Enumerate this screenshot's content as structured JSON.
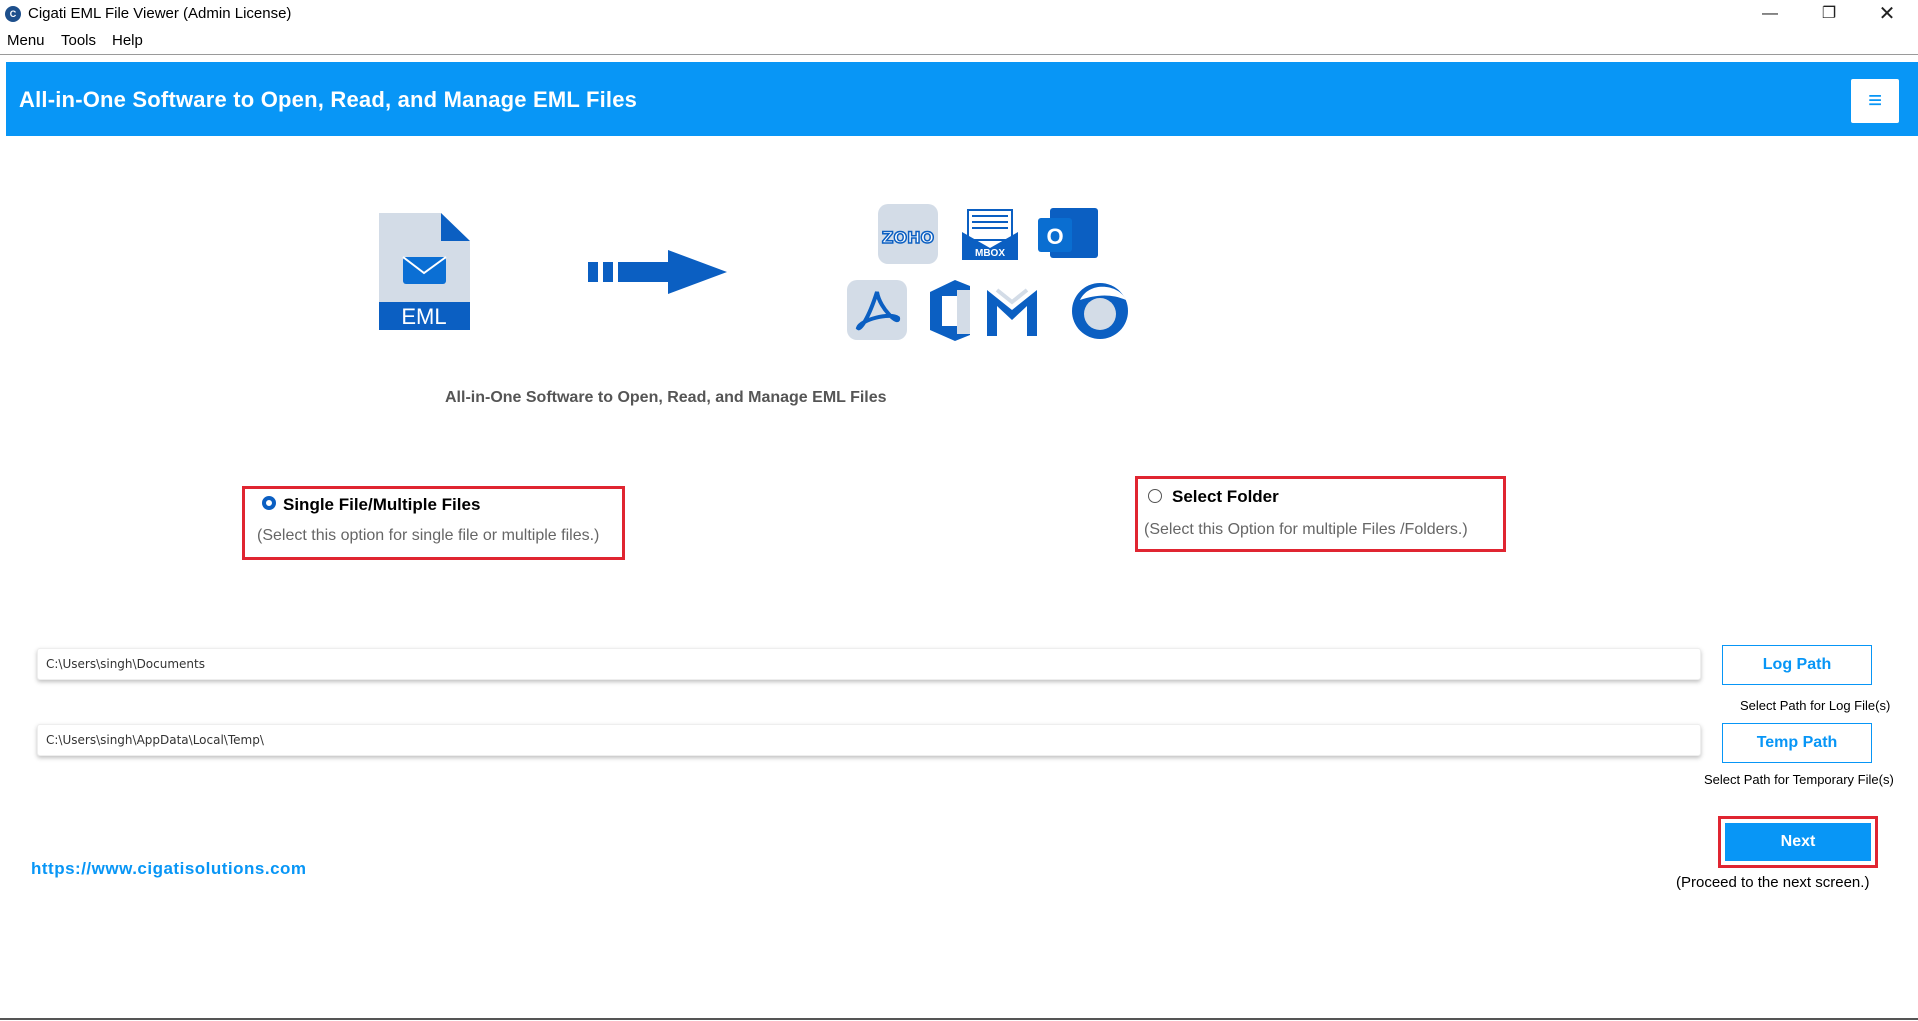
{
  "window": {
    "title": "Cigati EML File Viewer (Admin License)",
    "app_icon": "C",
    "controls": [
      "minimize-icon",
      "restore-icon",
      "close-icon"
    ]
  },
  "menubar": {
    "items": [
      "Menu",
      "Tools",
      "Help"
    ]
  },
  "banner": {
    "title": "All-in-One Software to Open, Read, and Manage EML Files",
    "menu_icon": "hamburger-icon"
  },
  "illustration": {
    "source_label": "EML",
    "targets": [
      "ZOHO",
      "MBOX",
      "O"
    ],
    "tagline": "All-in-One Software to Open, Read, and Manage EML Files"
  },
  "options": [
    {
      "title": "Single File/Multiple Files",
      "description": "(Select this option for single file or multiple files.)",
      "selected": true
    },
    {
      "title": "Select Folder",
      "description": "(Select this Option for multiple Files /Folders.)",
      "selected": false
    }
  ],
  "paths": {
    "log": {
      "value": "C:\\Users\\singh\\Documents",
      "button": "Log Path",
      "hint": "Select Path for Log File(s)"
    },
    "temp": {
      "value": "C:\\Users\\singh\\AppData\\Local\\Temp\\",
      "button": "Temp Path",
      "hint": "Select Path for  Temporary File(s)"
    }
  },
  "website": "https://www.cigatisolutions.com",
  "next": {
    "label": "Next",
    "hint": "(Proceed to the next screen.)"
  },
  "colors": {
    "accent": "#0896f6",
    "highlight": "#e02531",
    "dark_blue": "#0b5fc2"
  }
}
